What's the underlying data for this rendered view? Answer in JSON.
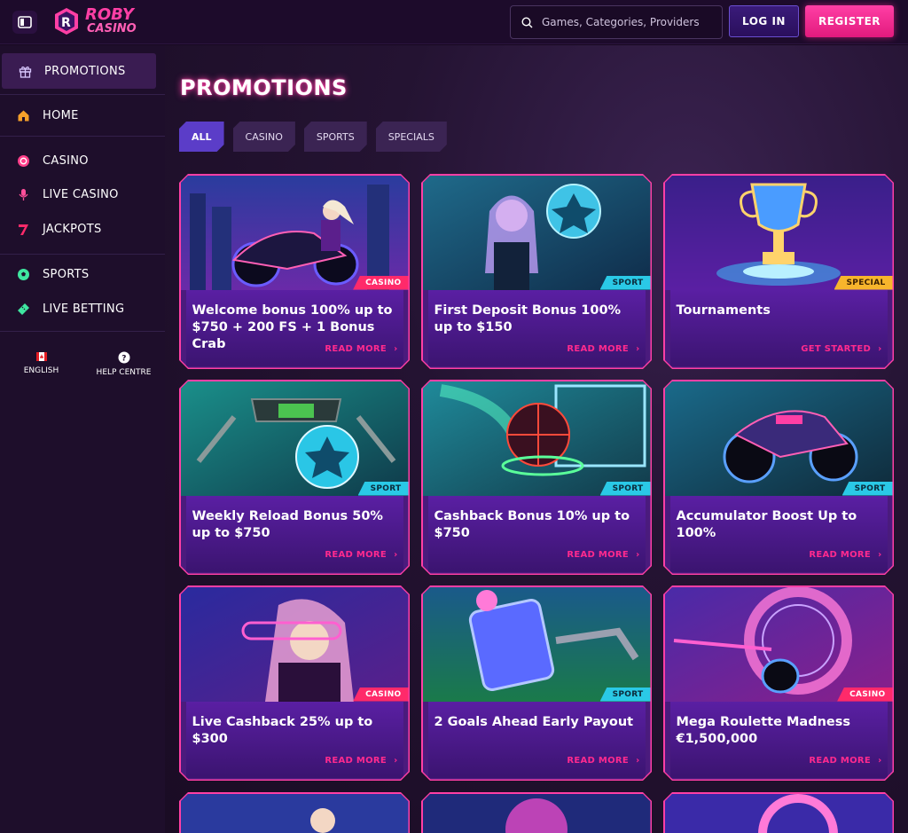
{
  "header": {
    "logo_top": "ROBY",
    "logo_bottom": "CASINO",
    "search_placeholder": "Games, Categories, Providers",
    "login_label": "LOG IN",
    "register_label": "REGISTER"
  },
  "sidebar": {
    "items": [
      {
        "label": "PROMOTIONS",
        "icon": "gift-icon"
      },
      {
        "label": "HOME",
        "icon": "home-icon"
      },
      {
        "label": "CASINO",
        "icon": "chip-icon"
      },
      {
        "label": "LIVE CASINO",
        "icon": "microphone-icon"
      },
      {
        "label": "JACKPOTS",
        "icon": "seven-icon"
      },
      {
        "label": "SPORTS",
        "icon": "soccer-ball-icon"
      },
      {
        "label": "LIVE BETTING",
        "icon": "ticket-icon"
      }
    ],
    "language_label": "ENGLISH",
    "help_label": "HELP CENTRE"
  },
  "main": {
    "title": "PROMOTIONS",
    "tabs": [
      "ALL",
      "CASINO",
      "SPORTS",
      "SPECIALS"
    ],
    "cards": [
      {
        "title": "Welcome bonus 100% up to $750 + 200 FS + 1 Bonus Crab",
        "badge": "CASINO",
        "cta": "READ MORE"
      },
      {
        "title": "First Deposit Bonus 100% up to $150",
        "badge": "SPORT",
        "cta": "READ MORE"
      },
      {
        "title": "Tournaments",
        "badge": "SPECIAL",
        "cta": "GET STARTED"
      },
      {
        "title": "Weekly Reload Bonus 50% up to $750",
        "badge": "SPORT",
        "cta": "READ MORE"
      },
      {
        "title": "Cashback Bonus 10% up to $750",
        "badge": "SPORT",
        "cta": "READ MORE"
      },
      {
        "title": "Accumulator Boost Up to 100%",
        "badge": "SPORT",
        "cta": "READ MORE"
      },
      {
        "title": "Live Cashback 25% up to $300",
        "badge": "CASINO",
        "cta": "READ MORE"
      },
      {
        "title": "2 Goals Ahead Early Payout",
        "badge": "SPORT",
        "cta": "READ MORE"
      },
      {
        "title": "Mega Roulette Madness €1,500,000",
        "badge": "CASINO",
        "cta": "READ MORE"
      }
    ]
  },
  "colors": {
    "accent_pink": "#ff3fa5",
    "accent_purple": "#5b3dc8",
    "sport_badge": "#2ac9e6",
    "special_badge": "#f7b52c"
  }
}
